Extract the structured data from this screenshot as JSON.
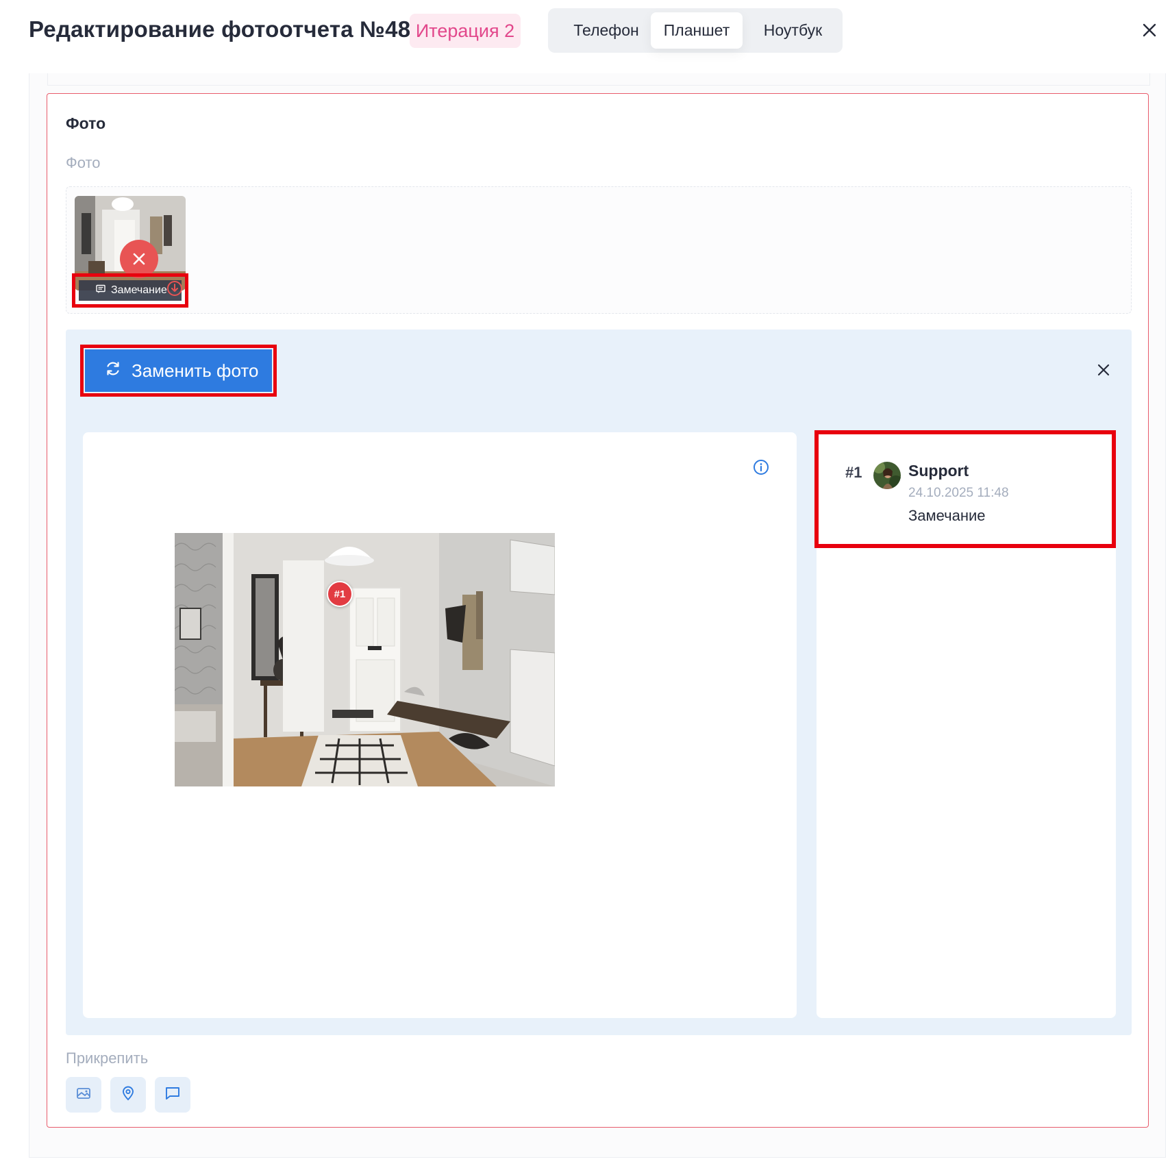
{
  "header": {
    "title": "Редактирование фотоотчета №48",
    "iteration_badge": "Итерация 2",
    "device_tabs": [
      {
        "label": "Телефон",
        "active": false
      },
      {
        "label": "Планшет",
        "active": true
      },
      {
        "label": "Ноутбук",
        "active": false
      }
    ]
  },
  "photo_field": {
    "title": "Фото",
    "sublabel": "Фото",
    "thumbnail_note_label": "Замечание"
  },
  "editor": {
    "replace_button_label": "Заменить фото",
    "marker_label": "#1"
  },
  "comments": [
    {
      "number": "#1",
      "author": "Support",
      "date": "24.10.2025 11:48",
      "text": "Замечание"
    }
  ],
  "attach": {
    "label": "Прикрепить",
    "buttons": [
      "image-icon",
      "map-pin-icon",
      "comment-icon"
    ]
  },
  "colors": {
    "accent_blue": "#2e7be0",
    "error_red": "#e85454",
    "highlight_red": "#e8000e",
    "badge_pink": "#e2478b",
    "editor_bg": "#e8f1fa"
  }
}
